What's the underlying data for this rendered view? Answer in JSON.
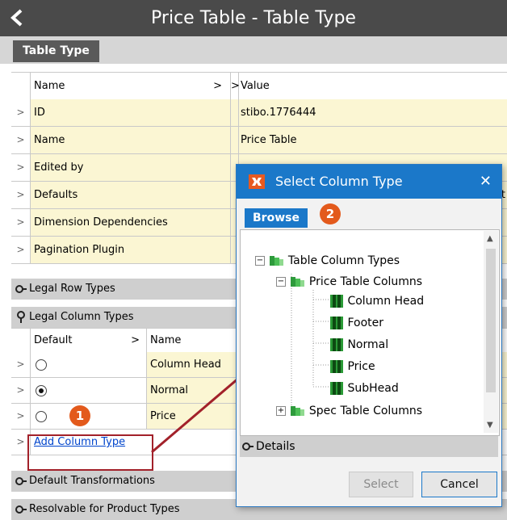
{
  "header": {
    "title": "Price Table - Table Type",
    "back_icon": "chevron-left-icon"
  },
  "tabs": {
    "active": "Table Type"
  },
  "grid": {
    "columns": {
      "name": "Name",
      "value": "Value"
    },
    "rows": [
      {
        "name": "ID",
        "value": "stibo.1776444"
      },
      {
        "name": "Name",
        "value": "Price Table"
      },
      {
        "name": "Edited by",
        "value": ""
      },
      {
        "name": "Defaults",
        "value": "t"
      },
      {
        "name": "Dimension Dependencies",
        "value": ""
      },
      {
        "name": "Pagination Plugin",
        "value": ""
      }
    ]
  },
  "sections": {
    "legal_row_types": "Legal Row Types",
    "legal_column_types": "Legal Column Types",
    "default_transformations": "Default Transformations",
    "resolvable": "Resolvable for Product Types"
  },
  "column_types": {
    "headers": {
      "default": "Default",
      "name": "Name"
    },
    "rows": [
      {
        "name": "Column Head",
        "selected": false
      },
      {
        "name": "Normal",
        "selected": true
      },
      {
        "name": "Price",
        "selected": false
      }
    ],
    "add_link": "Add Column Type"
  },
  "callouts": {
    "one": "1",
    "two": "2"
  },
  "accent_colors": {
    "dialog_blue": "#1b78c9",
    "callout_orange": "#e35a1c",
    "highlight_red": "#a2212a"
  },
  "dialog": {
    "title": "Select Column Type",
    "close": "✕",
    "tab": "Browse",
    "tree": {
      "root": "Table Column Types",
      "group": "Price Table Columns",
      "items": [
        "Column Head",
        "Footer",
        "Normal",
        "Price",
        "SubHead"
      ],
      "group2": "Spec Table Columns"
    },
    "details": "Details",
    "select_button": "Select",
    "cancel_button": "Cancel"
  }
}
